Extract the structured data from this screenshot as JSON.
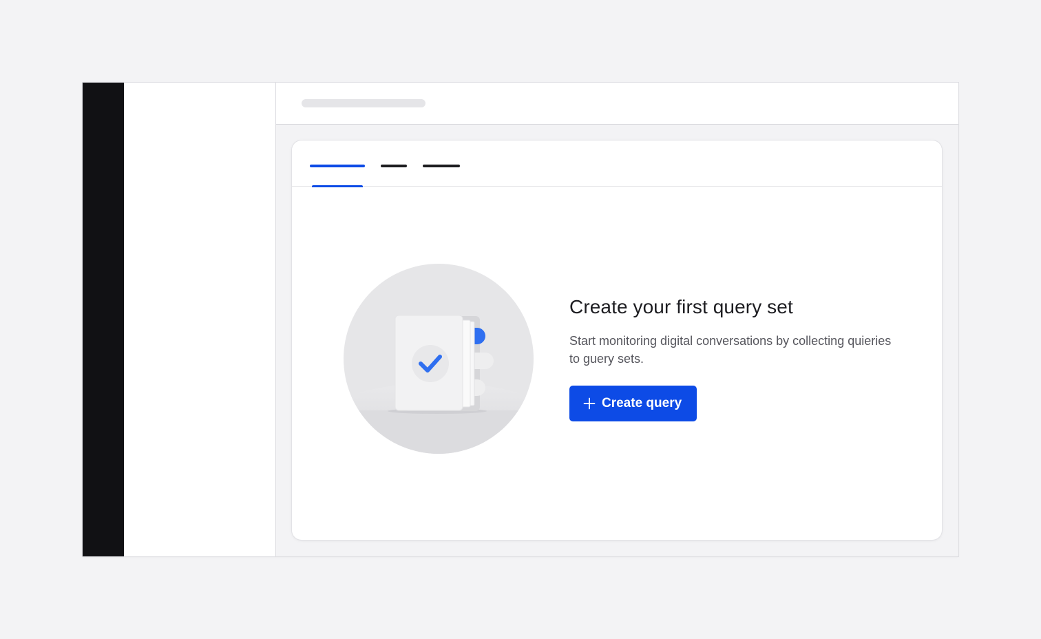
{
  "empty_state": {
    "title": "Create your first query set",
    "description": "Start monitoring digital conversations by collecting quieries to guery sets.",
    "button_label": "Create query",
    "button_icon": "plus-icon",
    "illustration_icon": "document-check-icon"
  },
  "tabs": [
    {
      "state": "active"
    },
    {
      "state": "inactive"
    },
    {
      "state": "inactive"
    }
  ],
  "colors": {
    "accent": "#0d4be6",
    "check": "#2f6ff0",
    "rail": "#111114",
    "background": "#f3f3f5"
  }
}
